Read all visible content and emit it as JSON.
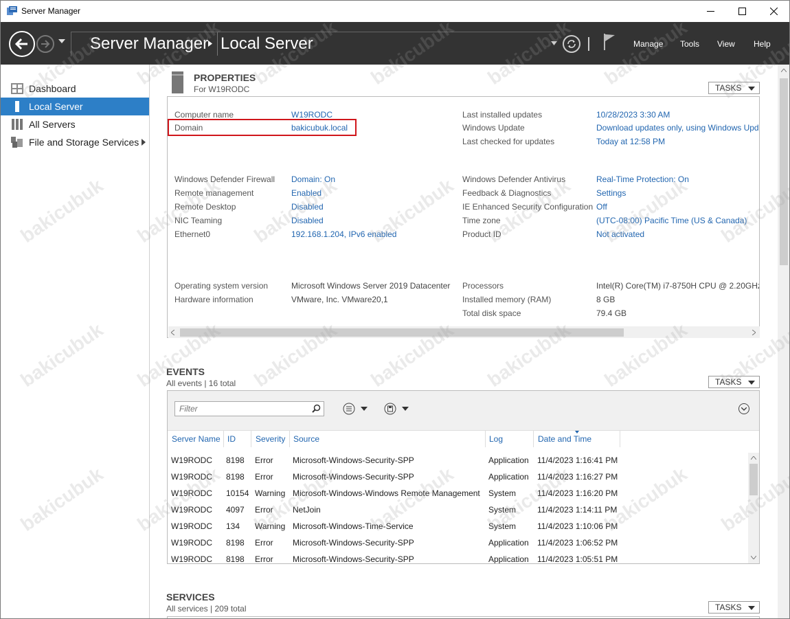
{
  "window": {
    "title": "Server Manager"
  },
  "header": {
    "breadcrumb_root": "Server Manager",
    "breadcrumb_page": "Local Server",
    "menus": [
      "Manage",
      "Tools",
      "View",
      "Help"
    ]
  },
  "sidebar": {
    "items": [
      {
        "label": "Dashboard",
        "icon": "dashboard-icon"
      },
      {
        "label": "Local Server",
        "icon": "server-icon",
        "active": true
      },
      {
        "label": "All Servers",
        "icon": "servers-icon"
      },
      {
        "label": "File and Storage Services",
        "icon": "storage-icon"
      }
    ]
  },
  "properties": {
    "title": "PROPERTIES",
    "subtitle": "For W19RODC",
    "tasks": "TASKS",
    "left": [
      {
        "label": "Computer name",
        "value": "W19RODC",
        "link": true
      },
      {
        "label": "Domain",
        "value": "bakicubuk.local",
        "link": true
      },
      {
        "label": "Windows Defender Firewall",
        "value": "Domain: On",
        "link": true
      },
      {
        "label": "Remote management",
        "value": "Enabled",
        "link": true
      },
      {
        "label": "Remote Desktop",
        "value": "Disabled",
        "link": true
      },
      {
        "label": "NIC Teaming",
        "value": "Disabled",
        "link": true
      },
      {
        "label": "Ethernet0",
        "value": "192.168.1.204, IPv6 enabled",
        "link": true
      },
      {
        "label": "Operating system version",
        "value": "Microsoft Windows Server 2019 Datacenter",
        "link": false
      },
      {
        "label": "Hardware information",
        "value": "VMware, Inc. VMware20,1",
        "link": false
      }
    ],
    "right": [
      {
        "label": "Last installed updates",
        "value": "10/28/2023 3:30 AM",
        "link": true
      },
      {
        "label": "Windows Update",
        "value": "Download updates only, using Windows Upd",
        "link": true
      },
      {
        "label": "Last checked for updates",
        "value": "Today at 12:58 PM",
        "link": true
      },
      {
        "label": "Windows Defender Antivirus",
        "value": "Real-Time Protection: On",
        "link": true
      },
      {
        "label": "Feedback & Diagnostics",
        "value": "Settings",
        "link": true
      },
      {
        "label": "IE Enhanced Security Configuration",
        "value": "Off",
        "link": true
      },
      {
        "label": "Time zone",
        "value": "(UTC-08:00) Pacific Time (US & Canada)",
        "link": true
      },
      {
        "label": "Product ID",
        "value": "Not activated",
        "link": true
      },
      {
        "label": "Processors",
        "value": "Intel(R) Core(TM) i7-8750H CPU @ 2.20GHz,",
        "link": false
      },
      {
        "label": "Installed memory (RAM)",
        "value": "8 GB",
        "link": false
      },
      {
        "label": "Total disk space",
        "value": "79.4 GB",
        "link": false
      }
    ]
  },
  "events": {
    "title": "EVENTS",
    "subtitle": "All events | 16 total",
    "tasks": "TASKS",
    "filter_placeholder": "Filter",
    "columns": [
      "Server Name",
      "ID",
      "Severity",
      "Source",
      "Log",
      "Date and Time"
    ],
    "rows": [
      [
        "W19RODC",
        "8198",
        "Error",
        "Microsoft-Windows-Security-SPP",
        "Application",
        "11/4/2023 1:16:41 PM"
      ],
      [
        "W19RODC",
        "8198",
        "Error",
        "Microsoft-Windows-Security-SPP",
        "Application",
        "11/4/2023 1:16:27 PM"
      ],
      [
        "W19RODC",
        "10154",
        "Warning",
        "Microsoft-Windows-Windows Remote Management",
        "System",
        "11/4/2023 1:16:20 PM"
      ],
      [
        "W19RODC",
        "4097",
        "Error",
        "NetJoin",
        "System",
        "11/4/2023 1:14:11 PM"
      ],
      [
        "W19RODC",
        "134",
        "Warning",
        "Microsoft-Windows-Time-Service",
        "System",
        "11/4/2023 1:10:06 PM"
      ],
      [
        "W19RODC",
        "8198",
        "Error",
        "Microsoft-Windows-Security-SPP",
        "Application",
        "11/4/2023 1:06:52 PM"
      ],
      [
        "W19RODC",
        "8198",
        "Error",
        "Microsoft-Windows-Security-SPP",
        "Application",
        "11/4/2023 1:05:51 PM"
      ]
    ]
  },
  "services": {
    "title": "SERVICES",
    "subtitle": "All services | 209 total",
    "tasks": "TASKS"
  },
  "watermark": "bakicubuk",
  "colors": {
    "header": "#333333",
    "accent": "#2d7fc7",
    "link": "#2266b0",
    "highlight": "#d0161b"
  }
}
